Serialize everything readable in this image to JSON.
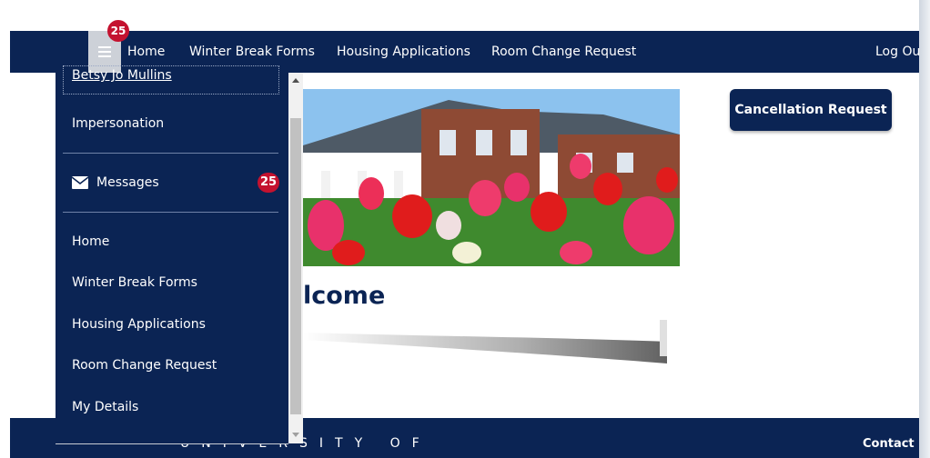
{
  "nav": {
    "badge_count": "25",
    "items": [
      "Home",
      "Winter Break Forms",
      "Housing Applications",
      "Room Change Request"
    ],
    "logout": "Log Ou"
  },
  "drawer": {
    "user_name": "Betsy Jo Mullins",
    "impersonation": "Impersonation",
    "messages_label": "Messages",
    "messages_count": "25",
    "items": [
      "Home",
      "Winter Break Forms",
      "Housing Applications",
      "Room Change Request",
      "My Details"
    ]
  },
  "main": {
    "welcome": "lcome",
    "cancel_button": "Cancellation Request"
  },
  "footer": {
    "university": "UNIVERSITY OF",
    "contact": "Contact U"
  }
}
